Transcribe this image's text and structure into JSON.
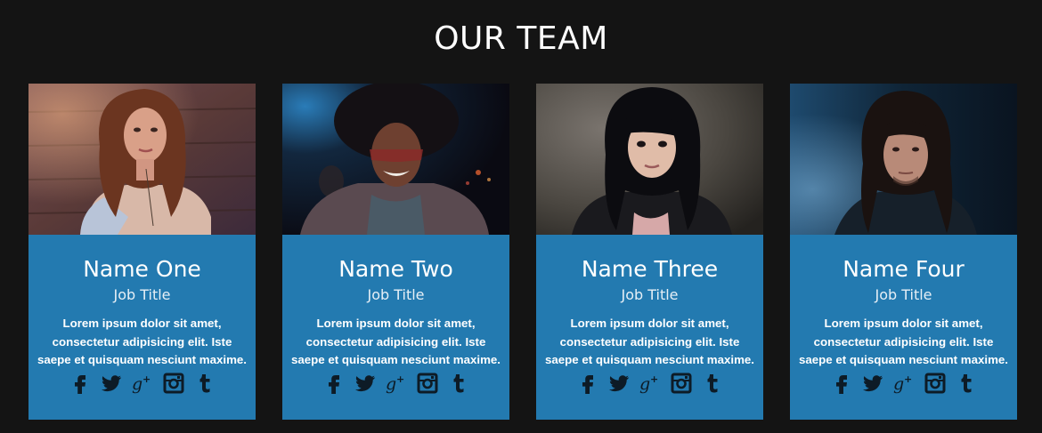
{
  "section": {
    "title": "OUR TEAM"
  },
  "colors": {
    "background": "#141414",
    "card": "#237ab0",
    "icon": "#0d1b26",
    "text": "#ffffff"
  },
  "members": [
    {
      "name": "Name One",
      "job_title": "Job Title",
      "bio": "Lorem ipsum dolor sit amet, consectetur adipisicing elit. Iste saepe et quisquam nesciunt maxime.",
      "photo": "photo-woman-auburn-hair",
      "socials": [
        "facebook-icon",
        "twitter-icon",
        "google-plus-icon",
        "instagram-icon",
        "tumblr-icon"
      ]
    },
    {
      "name": "Name Two",
      "job_title": "Job Title",
      "bio": "Lorem ipsum dolor sit amet, consectetur adipisicing elit. Iste saepe et quisquam nesciunt maxime.",
      "photo": "photo-man-afro-sunglasses",
      "socials": [
        "facebook-icon",
        "twitter-icon",
        "google-plus-icon",
        "instagram-icon",
        "tumblr-icon"
      ]
    },
    {
      "name": "Name Three",
      "job_title": "Job Title",
      "bio": "Lorem ipsum dolor sit amet, consectetur adipisicing elit. Iste saepe et quisquam nesciunt maxime.",
      "photo": "photo-woman-black-hair",
      "socials": [
        "facebook-icon",
        "twitter-icon",
        "google-plus-icon",
        "instagram-icon",
        "tumblr-icon"
      ]
    },
    {
      "name": "Name Four",
      "job_title": "Job Title",
      "bio": "Lorem ipsum dolor sit amet, consectetur adipisicing elit. Iste saepe et quisquam nesciunt maxime.",
      "photo": "photo-man-long-hair",
      "socials": [
        "facebook-icon",
        "twitter-icon",
        "google-plus-icon",
        "instagram-icon",
        "tumblr-icon"
      ]
    }
  ]
}
